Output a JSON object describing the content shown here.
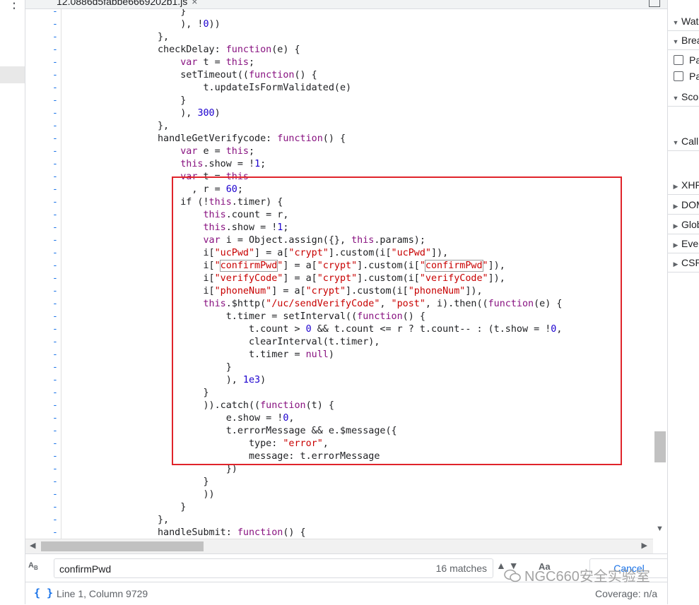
{
  "tab": {
    "filename": "12.0886d5fabbe6669202b1.js"
  },
  "code_lines": [
    {
      "t": "                    }"
    },
    {
      "t": "                    ), !0))"
    },
    {
      "t": "                },"
    },
    {
      "t": "                checkDelay: function(e) {"
    },
    {
      "t": "                    var t = this;"
    },
    {
      "t": "                    setTimeout((function() {"
    },
    {
      "t": "                        t.updateIsFormValidated(e)"
    },
    {
      "t": "                    }"
    },
    {
      "t": "                    ), 300)"
    },
    {
      "t": "                },"
    },
    {
      "t": "                handleGetVerifycode: function() {"
    },
    {
      "t": "                    var e = this;"
    },
    {
      "t": "                    this.show = !1;"
    },
    {
      "t": "                    var t = this"
    },
    {
      "t": "                      , r = 60;"
    },
    {
      "t": "                    if (!this.timer) {"
    },
    {
      "t": "                        this.count = r,"
    },
    {
      "t": "                        this.show = !1;"
    },
    {
      "t": "                        var i = Object.assign({}, this.params);"
    },
    {
      "t": "                        i[\"ucPwd\"] = a[\"crypt\"].custom(i[\"ucPwd\"]),"
    },
    {
      "t": "                        i[\"confirmPwd\"] = a[\"crypt\"].custom(i[\"confirmPwd\"]),"
    },
    {
      "t": "                        i[\"verifyCode\"] = a[\"crypt\"].custom(i[\"verifyCode\"]),"
    },
    {
      "t": "                        i[\"phoneNum\"] = a[\"crypt\"].custom(i[\"phoneNum\"]),"
    },
    {
      "t": "                        this.$http(\"/uc/sendVerifyCode\", \"post\", i).then((function(e) {"
    },
    {
      "t": "                            t.timer = setInterval((function() {"
    },
    {
      "t": "                                t.count > 0 && t.count <= r ? t.count-- : (t.show = !0,"
    },
    {
      "t": "                                clearInterval(t.timer),"
    },
    {
      "t": "                                t.timer = null)"
    },
    {
      "t": "                            }"
    },
    {
      "t": "                            ), 1e3)"
    },
    {
      "t": "                        }"
    },
    {
      "t": "                        )).catch((function(t) {"
    },
    {
      "t": "                            e.show = !0,"
    },
    {
      "t": "                            t.errorMessage && e.$message({"
    },
    {
      "t": "                                type: \"error\","
    },
    {
      "t": "                                message: t.errorMessage"
    },
    {
      "t": "                            })"
    },
    {
      "t": "                        }"
    },
    {
      "t": "                        ))"
    },
    {
      "t": "                    }"
    },
    {
      "t": "                },"
    },
    {
      "t": "                handleSubmit: function() {"
    }
  ],
  "gutter_mark": "-",
  "search": {
    "value": "confirmPwd",
    "matches": "16 matches",
    "cancel_label": "Cancel"
  },
  "status": {
    "position": "Line 1, Column 9729",
    "coverage": "Coverage: n/a"
  },
  "watermark": "NGC660安全实验室",
  "right_panel": {
    "sections": [
      "Watch",
      "Breakpoints",
      "Scope",
      "Call Stack",
      "XHR/fetch Breakpoints",
      "DOM Breakpoints",
      "Global Listeners",
      "Event Listener Breakpoints",
      "CSP Violation Breakpoints"
    ],
    "checkboxes": [
      "Pause on uncaught exceptions",
      "Pause on caught exceptions"
    ]
  },
  "colors": {
    "keyword": "#881280",
    "string": "#c80000",
    "number": "#1c00cf",
    "annotation": "#e0242b",
    "accent": "#1a73e8"
  }
}
